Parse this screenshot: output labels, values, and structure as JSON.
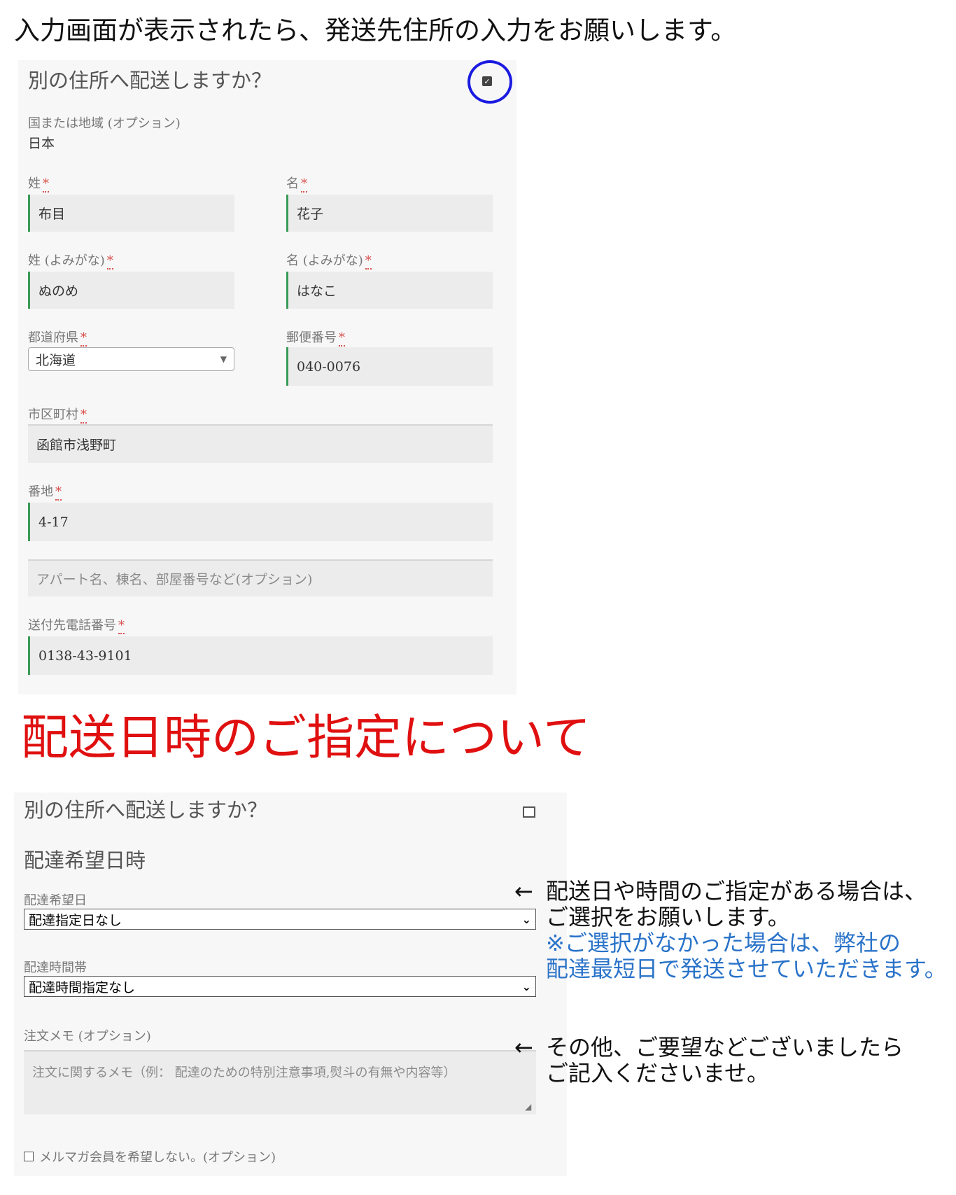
{
  "intro_text": "入力画面が表示されたら、発送先住所の入力をお願いします。",
  "panel1": {
    "heading": "別の住所へ配送しますか？",
    "country_label": "国または地域 (オプション)",
    "country_value": "日本",
    "required_mark": "*",
    "last_name_label": "姓",
    "last_name_value": "布目",
    "first_name_label": "名",
    "first_name_value": "花子",
    "last_kana_label": "姓 (よみがな)",
    "last_kana_value": "ぬのめ",
    "first_kana_label": "名 (よみがな)",
    "first_kana_value": "はなこ",
    "prefecture_label": "都道府県",
    "prefecture_value": "北海道",
    "postal_label": "郵便番号",
    "postal_value": "040-0076",
    "city_label": "市区町村",
    "city_value": "函館市浅野町",
    "address_label": "番地",
    "address_value": "4-17",
    "apartment_placeholder": "アパート名、棟名、部屋番号など(オプション)",
    "phone_label": "送付先電話番号",
    "phone_value": "0138-43-9101"
  },
  "section_heading": "配送日時のご指定について",
  "panel2": {
    "heading": "別の住所へ配送しますか？",
    "subheading": "配達希望日時",
    "date_label": "配達希望日",
    "date_value": "配達指定日なし",
    "time_label": "配達時間帯",
    "time_value": "配達時間指定なし",
    "memo_label": "注文メモ (オプション)",
    "memo_placeholder": "注文に関するメモ（例： 配達のための特別注意事項,熨斗の有無や内容等）",
    "newsletter_label": "メルマガ会員を希望しない。(オプション)"
  },
  "notes": {
    "arrow": "←",
    "date_note_line1": "配送日や時間のご指定がある場合は、",
    "date_note_line2": "ご選択をお願いします。",
    "date_note_blue1": "※ご選択がなかった場合は、弊社の",
    "date_note_blue2": "配達最短日で発送させていただきます。",
    "memo_note_line1": "その他、ご要望などございましたら",
    "memo_note_line2": "ご記入くださいませ。"
  },
  "colors": {
    "red_heading": "#e01010",
    "blue_note": "#2a73c9",
    "circle": "#1a1ae0",
    "field_accent": "#3a9a57"
  }
}
